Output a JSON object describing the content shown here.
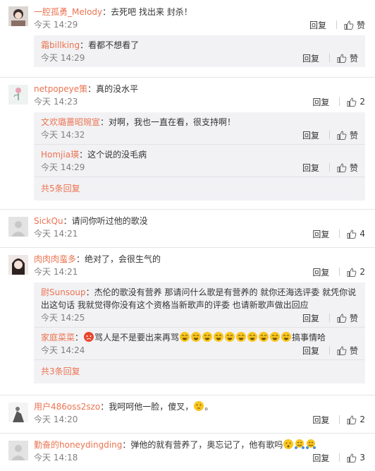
{
  "like_label": "赞",
  "reply_label": "回复",
  "comments": [
    {
      "user": "一腔孤勇_Melody",
      "text": "：去死吧  找出来 封杀！",
      "time": "今天 14:29",
      "reply": "回复",
      "like": "赞",
      "subs": [
        {
          "user": "霜billking",
          "text": "：看都不想看了",
          "time": "今天 14:29",
          "reply": "回复",
          "like": "赞"
        }
      ]
    },
    {
      "user": "netpopeye策",
      "text": "：真的没水平",
      "time": "今天 14:23",
      "reply": "回复",
      "like": "2",
      "subs": [
        {
          "user": "文欢璐蔷昭琬宣",
          "text": "：对啊，我也一直在看，很支持啊！",
          "time": "今天 14:32",
          "reply": "回复",
          "like": "赞"
        },
        {
          "user": "Homjia瑛",
          "text": "：这个说的没毛病",
          "time": "今天 14:29",
          "reply": "回复",
          "like": "赞"
        }
      ],
      "more": "共5条回复"
    },
    {
      "user": "SickQu",
      "text": "：请问你听过他的歌没",
      "time": "今天 14:21",
      "reply": "回复",
      "like": "4"
    },
    {
      "user": "肉肉肉蛮多",
      "text": "：绝对了，会很生气的",
      "time": "今天 14:21",
      "reply": "回复",
      "like": "2",
      "subs": [
        {
          "user": "尉Sunsoup",
          "text": "：杰伦的歌没有营养 那请问什么歌是有营养的 就你还海选评委 就凭你说出这句话 我就觉得你没有这个资格当新歌声的评委 也请新歌声做出回应",
          "time": "今天 14:25",
          "reply": "回复",
          "like": "赞"
        },
        {
          "user": "家庭菜菜",
          "text_a": "：",
          "text_b": "骂人是不是要出来再骂",
          "text_c": "搞事情哈",
          "time": "今天 14:24",
          "reply": "回复",
          "like": "赞"
        }
      ],
      "more": "共3条回复"
    },
    {
      "user": "用户486oss2szo",
      "text": "：我呵呵他一脸，傻叉，",
      "text_end": "。",
      "time": "今天 14:20",
      "reply": "回复",
      "like": "2"
    },
    {
      "user": "勤奋的honeydingding",
      "text": "：弹他的就有营养了，奥忘记了，他有歌吗",
      "time": "今天 14:18",
      "reply": "回复",
      "like": "3"
    }
  ],
  "colors": {
    "username": "#eb7350",
    "time": "#808080",
    "subbg": "#f2f2f5"
  }
}
